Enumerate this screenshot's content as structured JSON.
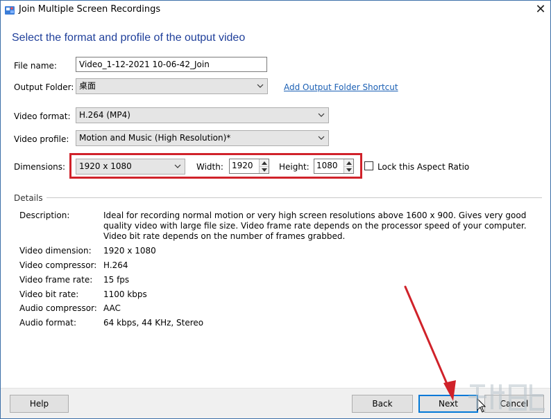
{
  "window": {
    "title": "Join Multiple Screen Recordings",
    "close_glyph": "✕"
  },
  "heading": "Select the format and profile of the output video",
  "form": {
    "file_name_label": "File name:",
    "file_name_value": "Video_1-12-2021 10-06-42_Join",
    "output_folder_label": "Output Folder:",
    "output_folder_value": "桌面",
    "add_shortcut_link": "Add Output Folder Shortcut",
    "video_format_label": "Video format:",
    "video_format_value": "H.264 (MP4)",
    "video_profile_label": "Video profile:",
    "video_profile_value": "Motion and Music (High Resolution)*",
    "dimensions_label": "Dimensions:",
    "dimensions_value": "1920 x 1080",
    "width_label": "Width:",
    "width_value": "1920",
    "height_label": "Height:",
    "height_value": "1080",
    "lock_aspect_label": "Lock this Aspect Ratio",
    "lock_aspect_checked": false
  },
  "details": {
    "section_label": "Details",
    "description_label": "Description:",
    "description_value": "Ideal for recording normal motion or very high screen resolutions above 1600 x 900.  Gives very good quality video with large file size. Video frame rate depends on the processor speed of your computer. Video bit rate depends on the number of frames grabbed.",
    "rows": [
      {
        "label": "Video dimension:",
        "value": "1920 x 1080"
      },
      {
        "label": "Video compressor:",
        "value": "H.264"
      },
      {
        "label": "Video frame rate:",
        "value": "15 fps"
      },
      {
        "label": "Video bit rate:",
        "value": "1100 kbps"
      },
      {
        "label": "Audio compressor:",
        "value": "AAC"
      },
      {
        "label": "Audio format:",
        "value": "64 kbps, 44 KHz, Stereo"
      }
    ]
  },
  "buttons": {
    "help": "Help",
    "back": "Back",
    "next": "Next",
    "cancel": "Cancel"
  },
  "colors": {
    "heading": "#1f3f9a",
    "link": "#1a5fb4",
    "highlight": "#d0222a",
    "annotation_arrow": "#d0222a",
    "default_button_border": "#0078d7"
  },
  "icons": {
    "app": "app-recorder-icon",
    "close": "close-icon",
    "dropdown": "chevron-down-icon",
    "spin_up": "spin-up-icon",
    "spin_down": "spin-down-icon"
  }
}
